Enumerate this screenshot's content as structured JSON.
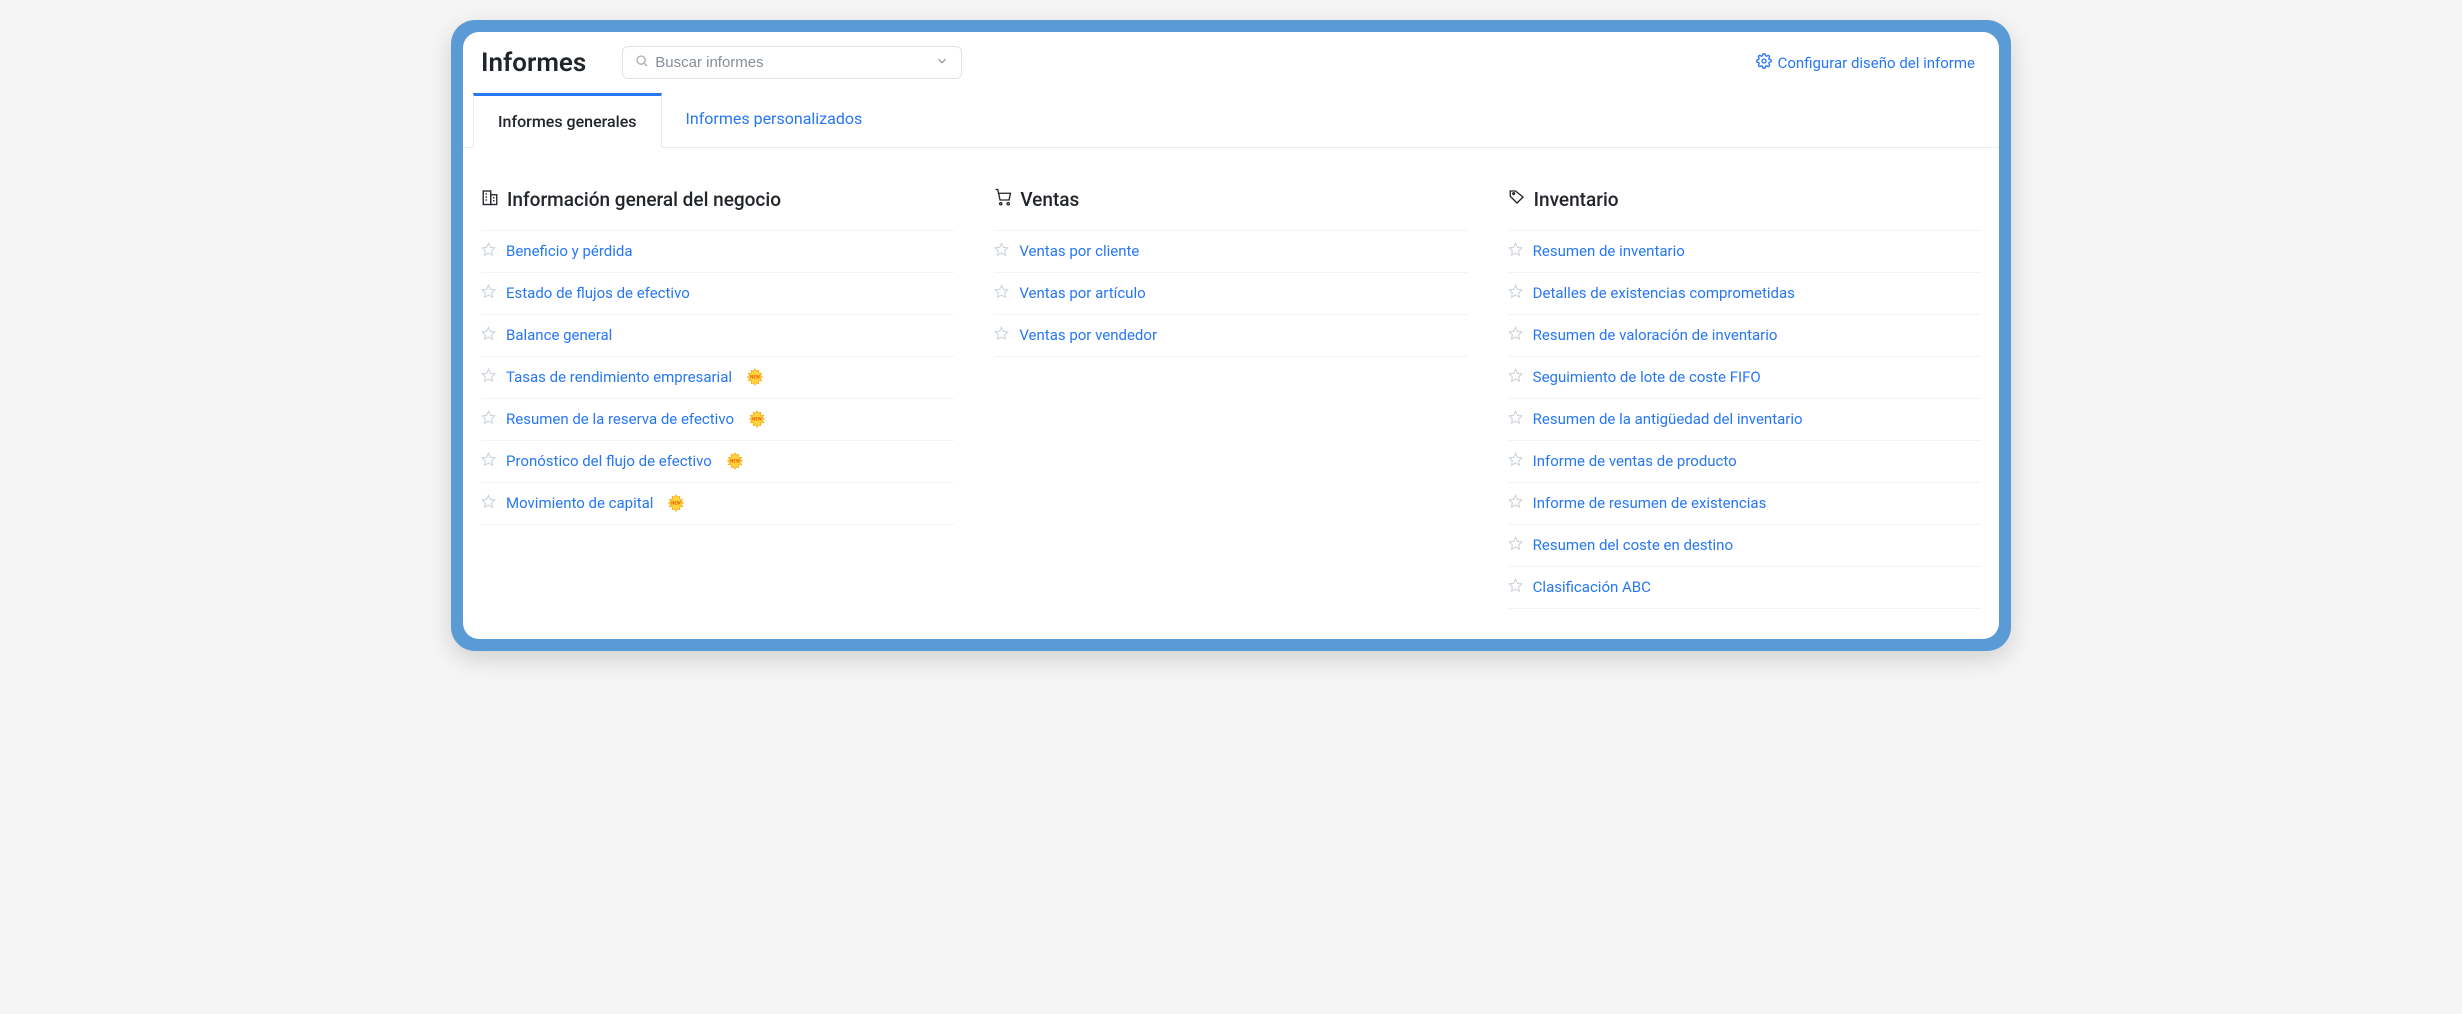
{
  "header": {
    "title": "Informes",
    "search_placeholder": "Buscar informes",
    "config_label": "Configurar diseño del informe"
  },
  "tabs": {
    "general": "Informes generales",
    "custom": "Informes personalizados"
  },
  "columns": {
    "business": {
      "title": "Información general del negocio",
      "items": [
        {
          "label": "Beneficio y pérdida",
          "new": false
        },
        {
          "label": "Estado de flujos de efectivo",
          "new": false
        },
        {
          "label": "Balance general",
          "new": false
        },
        {
          "label": "Tasas de rendimiento empresarial",
          "new": true
        },
        {
          "label": "Resumen de la reserva de efectivo",
          "new": true
        },
        {
          "label": "Pronóstico del flujo de efectivo",
          "new": true
        },
        {
          "label": "Movimiento de capital",
          "new": true
        }
      ]
    },
    "sales": {
      "title": "Ventas",
      "items": [
        {
          "label": "Ventas por cliente",
          "new": false
        },
        {
          "label": "Ventas por artículo",
          "new": false
        },
        {
          "label": "Ventas por vendedor",
          "new": false
        }
      ]
    },
    "inventory": {
      "title": "Inventario",
      "items": [
        {
          "label": "Resumen de inventario",
          "new": false
        },
        {
          "label": "Detalles de existencias comprometidas",
          "new": false
        },
        {
          "label": "Resumen de valoración de inventario",
          "new": false
        },
        {
          "label": "Seguimiento de lote de coste FIFO",
          "new": false
        },
        {
          "label": "Resumen de la antigüedad del inventario",
          "new": false
        },
        {
          "label": "Informe de ventas de producto",
          "new": false
        },
        {
          "label": "Informe de resumen de existencias",
          "new": false
        },
        {
          "label": "Resumen del coste en destino",
          "new": false
        },
        {
          "label": "Clasificación ABC",
          "new": false
        }
      ]
    }
  }
}
